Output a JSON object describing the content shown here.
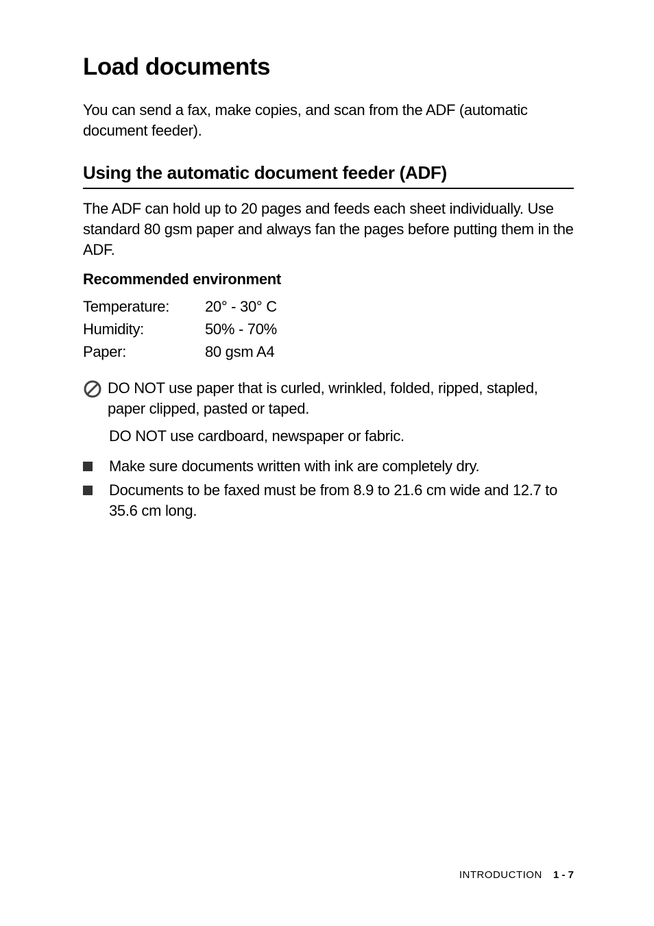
{
  "title": "Load documents",
  "intro": "You can send a fax, make copies, and scan from the ADF (automatic document feeder).",
  "section": {
    "title": "Using the automatic document feeder (ADF)",
    "text": "The ADF can hold up to 20 pages and feeds each sheet individually. Use standard 80 gsm paper and always fan the pages before putting them in the ADF."
  },
  "subsection": {
    "title": "Recommended environment",
    "rows": [
      {
        "label": "Temperature:",
        "value": "20° - 30° C"
      },
      {
        "label": "Humidity:",
        "value": "50% - 70%"
      },
      {
        "label": "Paper:",
        "value": "80 gsm A4"
      }
    ]
  },
  "caution": {
    "line1": "DO NOT use paper that is curled, wrinkled, folded, ripped, stapled, paper clipped, pasted or taped.",
    "line2": "DO NOT use cardboard, newspaper or fabric."
  },
  "bullets": [
    "Make sure documents written with ink are completely dry.",
    "Documents to be faxed must be from 8.9 to 21.6 cm wide and 12.7 to 35.6 cm long."
  ],
  "footer": {
    "section": "INTRODUCTION",
    "page": "1 - 7"
  }
}
